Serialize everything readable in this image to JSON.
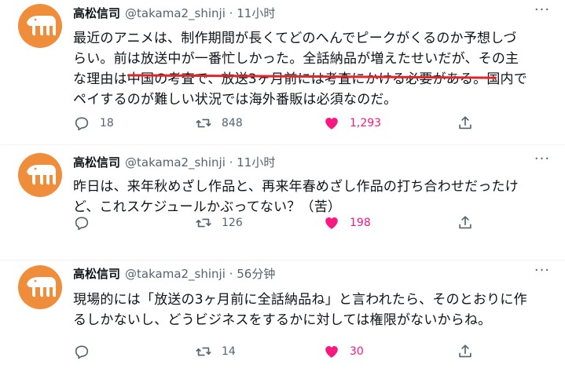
{
  "colors": {
    "accent_like": "#f91880",
    "secondary_text": "#536471",
    "avatar_bg": "#ef8d3a",
    "underline": "#e0262b"
  },
  "tweets": [
    {
      "name": "高松信司",
      "handle": "@takama2_shinji",
      "dot": "·",
      "time": "11小时",
      "lines": [
        "最近のアニメは、制作期間が長くてどのへんでピークがくるのか予想しづ",
        "らい。前は放送中が一番忙しかった。全話納品が増えたせいだが、その主",
        "な理由は中国の考査で、放送3ヶ月前には考査にかける必要がある。国内で",
        "ペイするのが難しい状況では海外番販は必須なのだ。"
      ],
      "replies": "18",
      "retweets": "848",
      "likes": "1,293"
    },
    {
      "name": "高松信司",
      "handle": "@takama2_shinji",
      "dot": "·",
      "time": "11小时",
      "lines": [
        "昨日は、来年秋めざし作品と、再来年春めざし作品の打ち合わせだったけ",
        "ど、これスケジュールかぶってない？（苦）"
      ],
      "replies": "",
      "retweets": "126",
      "likes": "198"
    },
    {
      "name": "高松信司",
      "handle": "@takama2_shinji",
      "dot": "·",
      "time": "56分钟",
      "lines": [
        "現場的には「放送の3ヶ月前に全話納品ね」と言われたら、そのとおりに作",
        "るしかないし、どうビジネスをするかに対しては権限がないからね。"
      ],
      "replies": "",
      "retweets": "14",
      "likes": "30"
    }
  ],
  "icons": {
    "reply": "reply-icon",
    "retweet": "retweet-icon",
    "like": "heart-icon",
    "share": "share-icon",
    "more": "more-icon"
  }
}
